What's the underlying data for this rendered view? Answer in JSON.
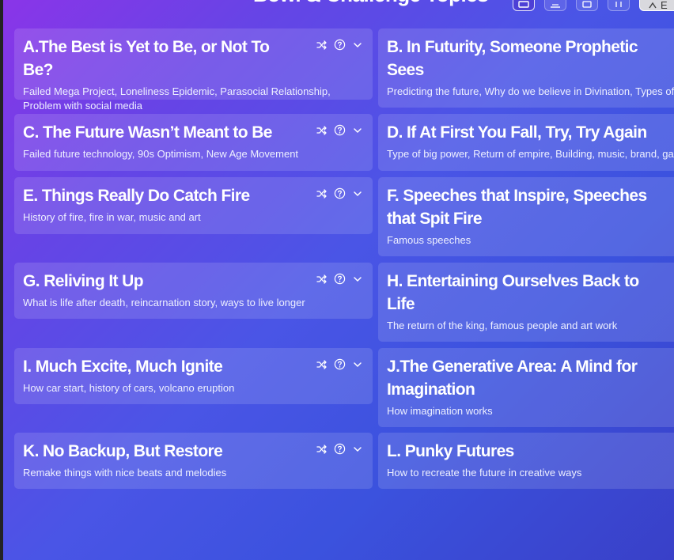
{
  "header": {
    "title": "Bowl & Challenge Topics",
    "buttons": [
      {
        "icon": "grid-view-icon",
        "active": true
      },
      {
        "icon": "image-view-icon",
        "active": false
      },
      {
        "icon": "calendar-icon",
        "active": false
      },
      {
        "icon": "people-icon",
        "active": false
      },
      {
        "icon": "expand-icon",
        "label": "E",
        "active": false
      }
    ]
  },
  "topics": [
    {
      "title": "A.The Best is Yet to Be, or Not To Be?",
      "description": "Failed Mega Project, Loneliness Epidemic, Parasocial Relationship, Problem with social media"
    },
    {
      "title": "B. In Futurity, Someone Prophetic Sees",
      "description": "Predicting the future, Why do we believe in Divination, Types of"
    },
    {
      "title": "C. The Future Wasn’t Meant to Be",
      "description": "Failed future technology, 90s Optimism, New Age Movement"
    },
    {
      "title": "D. If At First You Fall, Try, Try Again",
      "description": "Type of big power, Return of empire, Building, music, brand, ga"
    },
    {
      "title": "E. Things Really Do Catch Fire",
      "description": "History of fire, fire in war, music and art"
    },
    {
      "title": "F. Speeches that Inspire, Speeches that Spit Fire",
      "description": "Famous speeches"
    },
    {
      "title": "G. Reliving It Up",
      "description": "What is life after death, reincarnation story, ways to live longer"
    },
    {
      "title": "H. Entertaining Ourselves Back to Life",
      "description": "The return of the king, famous people and art work"
    },
    {
      "title": "I. Much Excite, Much Ignite",
      "description": "How car start, history of cars, volcano eruption"
    },
    {
      "title": "J.The Generative Area: A Mind for Imagination",
      "description": "How imagination works"
    },
    {
      "title": "K. No Backup, But Restore",
      "description": "Remake things with nice beats and melodies"
    },
    {
      "title": "L. Punky Futures",
      "description": "How to recreate the future in creative ways"
    }
  ],
  "card_actions": {
    "icons": [
      "shuffle-icon",
      "help-circle-icon",
      "chevron-down-icon"
    ]
  },
  "colors": {
    "gradient_start": "#8a35e8",
    "gradient_end": "#3940c8",
    "card_bg": "rgba(255,255,255,0.13)",
    "text": "#ffffff"
  }
}
